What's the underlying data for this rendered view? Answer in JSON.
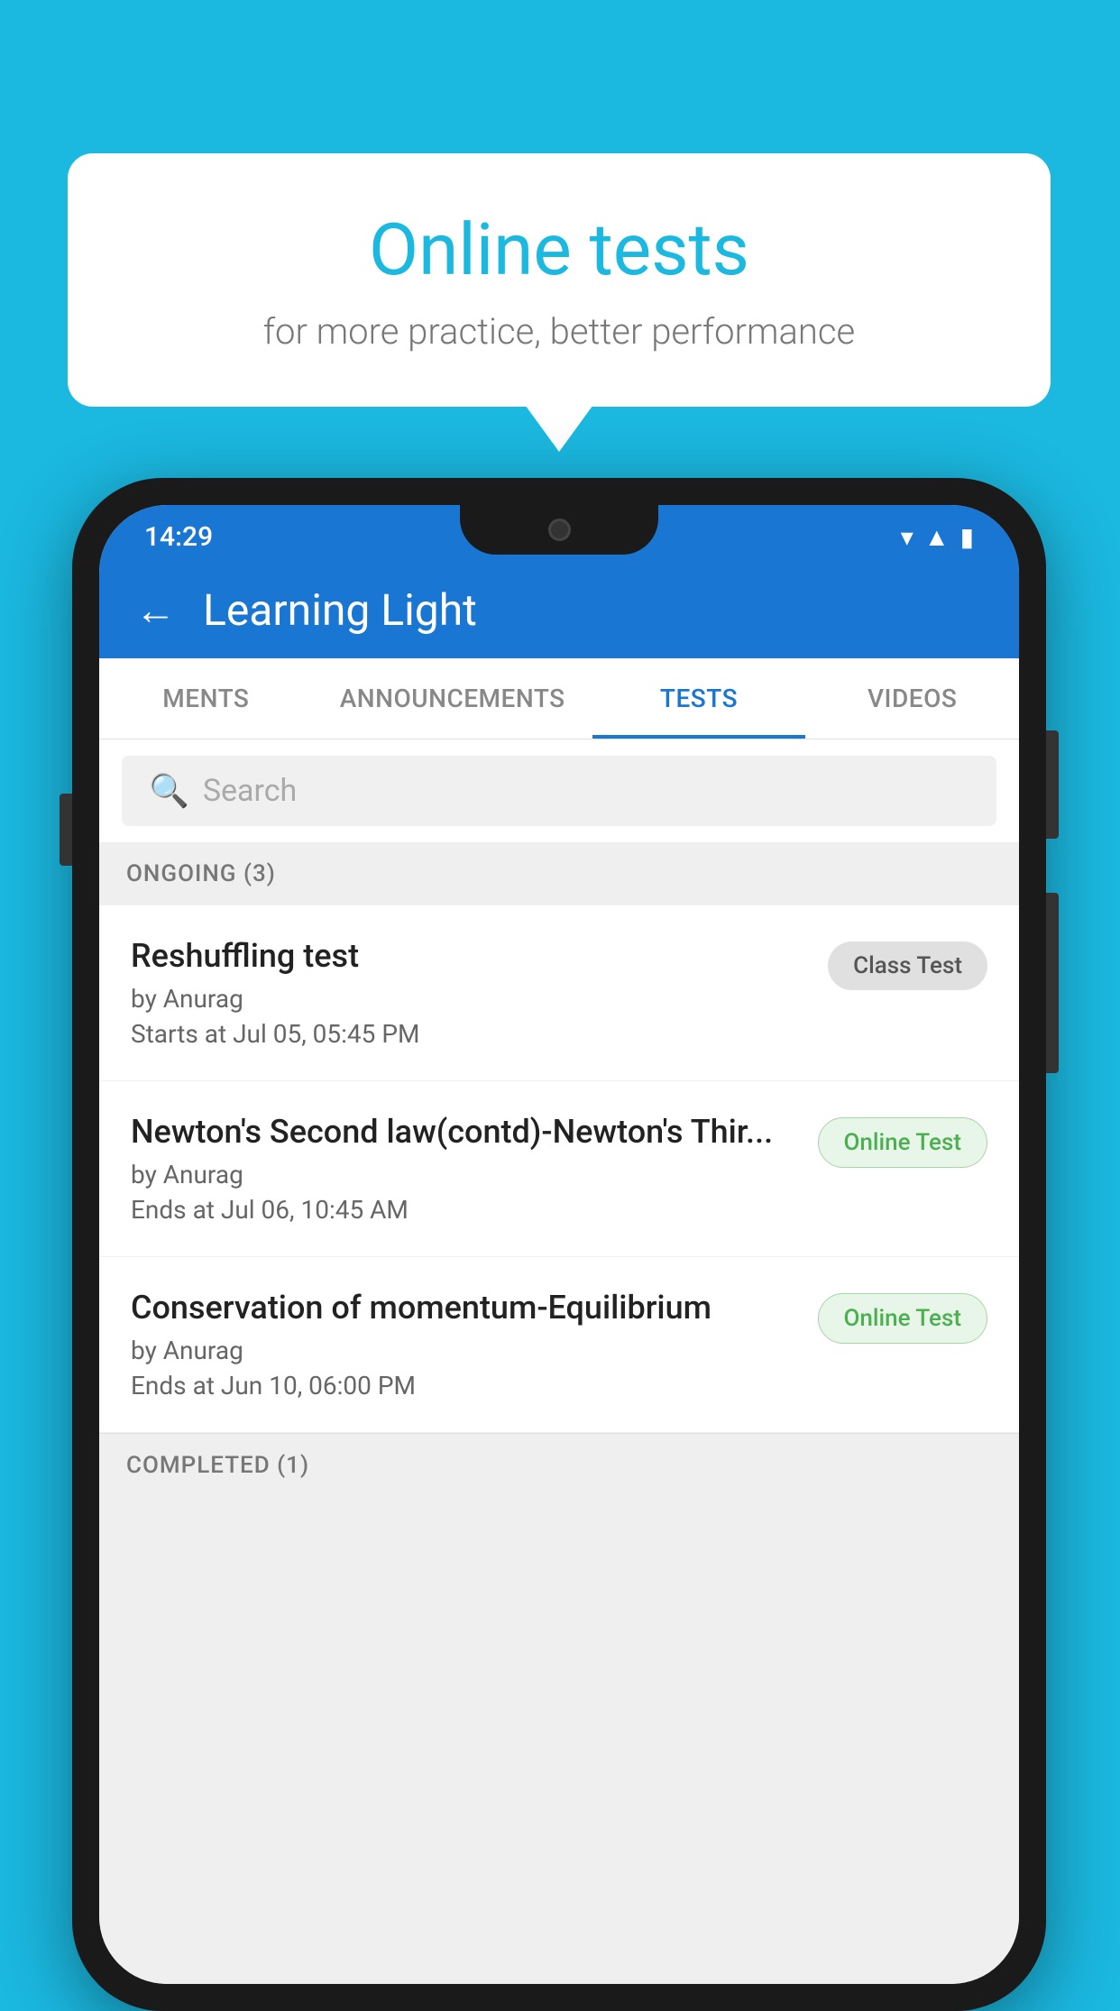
{
  "background": {
    "color": "#1bb8e0"
  },
  "speech_bubble": {
    "title": "Online tests",
    "subtitle": "for more practice, better performance"
  },
  "phone": {
    "status_bar": {
      "time": "14:29",
      "icons": [
        "wifi",
        "signal",
        "battery"
      ]
    },
    "header": {
      "back_label": "←",
      "title": "Learning Light"
    },
    "tabs": [
      {
        "label": "MENTS",
        "active": false
      },
      {
        "label": "ANNOUNCEMENTS",
        "active": false
      },
      {
        "label": "TESTS",
        "active": true
      },
      {
        "label": "VIDEOS",
        "active": false
      }
    ],
    "search": {
      "placeholder": "Search"
    },
    "ongoing_section": {
      "label": "ONGOING (3)"
    },
    "tests": [
      {
        "name": "Reshuffling test",
        "author": "by Anurag",
        "time_label": "Starts at",
        "time": "Jul 05, 05:45 PM",
        "badge": "Class Test",
        "badge_type": "class"
      },
      {
        "name": "Newton's Second law(contd)-Newton's Thir...",
        "author": "by Anurag",
        "time_label": "Ends at",
        "time": "Jul 06, 10:45 AM",
        "badge": "Online Test",
        "badge_type": "online"
      },
      {
        "name": "Conservation of momentum-Equilibrium",
        "author": "by Anurag",
        "time_label": "Ends at",
        "time": "Jun 10, 06:00 PM",
        "badge": "Online Test",
        "badge_type": "online"
      }
    ],
    "completed_section": {
      "label": "COMPLETED (1)"
    }
  }
}
